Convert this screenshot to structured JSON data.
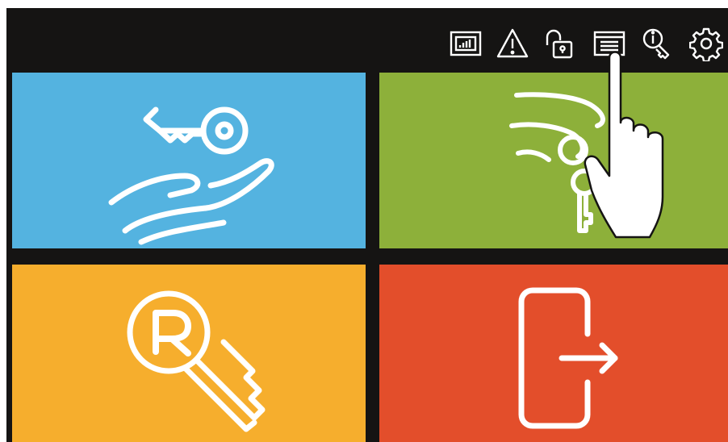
{
  "screen": {
    "background": "#151413"
  },
  "toolbar": {
    "icons": [
      {
        "name": "statistics-icon",
        "label": ""
      },
      {
        "name": "warning-icon",
        "label": ""
      },
      {
        "name": "unlock-icon",
        "label": ""
      },
      {
        "name": "card-reader-icon",
        "label": ""
      },
      {
        "name": "key-info-icon",
        "label": ""
      },
      {
        "name": "settings-icon",
        "label": ""
      }
    ],
    "icon_color": "#ffffff"
  },
  "tiles": [
    {
      "name": "tile-key-handover",
      "icon": "hand-key-icon",
      "color": "#54b3e0"
    },
    {
      "name": "tile-key-return",
      "icon": "keys-in-hand-icon",
      "color": "#8db03a"
    },
    {
      "name": "tile-reserved-key",
      "icon": "reserved-key-icon",
      "color": "#f6ae2d"
    },
    {
      "name": "tile-exit",
      "icon": "exit-door-icon",
      "color": "#e34e2b"
    }
  ],
  "overlay": {
    "pointer": "pointing-hand-icon"
  }
}
